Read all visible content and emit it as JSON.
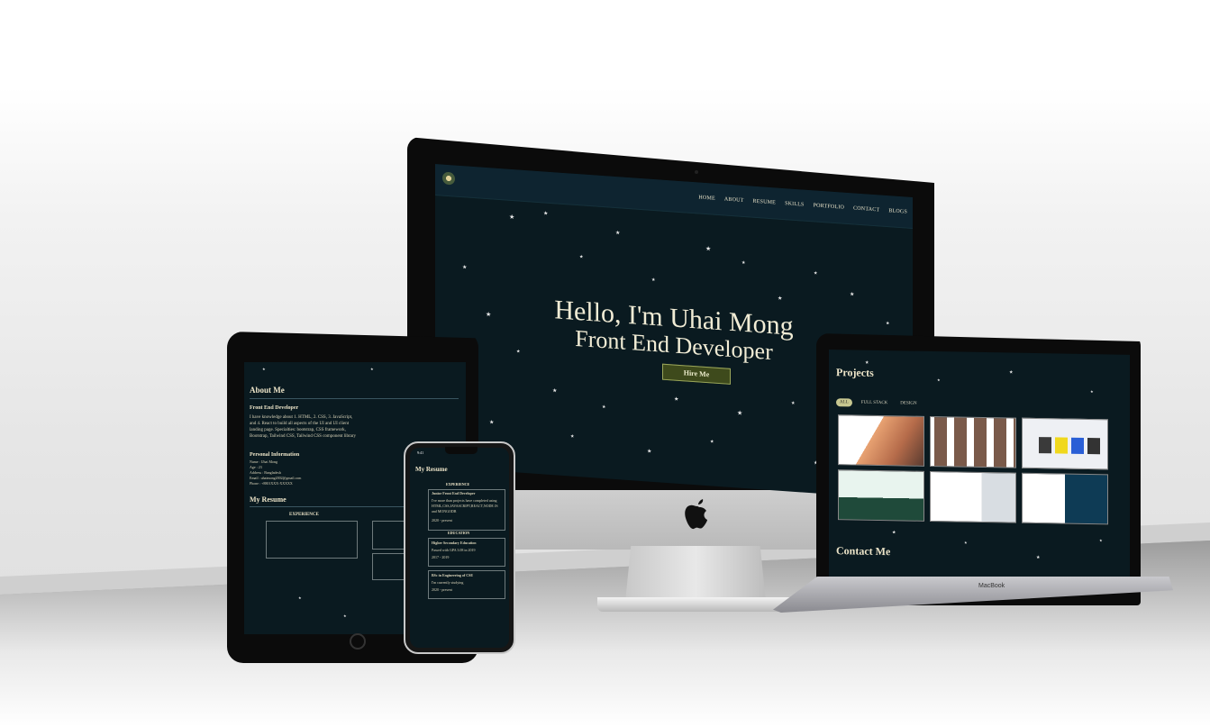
{
  "imac": {
    "nav": [
      "HOME",
      "ABOUT",
      "RESUME",
      "SKILLS",
      "PORTFOLIO",
      "CONTACT",
      "BLOGS"
    ],
    "hero_line1": "Hello, I'm Uhai Mong",
    "hero_line2": "Front End Developer",
    "cta": "Hire Me"
  },
  "macbook": {
    "section_title": "Projects",
    "filters": [
      "ALL",
      "FULL STACK",
      "DESIGN"
    ],
    "contact_title": "Contact Me",
    "brand": "MacBook"
  },
  "ipad": {
    "about_title": "About Me",
    "role": "Front End Developer",
    "about_text": "I have knowledge about 1. HTML, 2. CSS, 3. JavaScript, and 4. React to build all aspects of the UI and UI client landing page. Specialties: bootstrap, CSS framework, Bootstrap, Tailwind CSS, Tailwind CSS component library to build seamless UI containers clear.",
    "personal_title": "Personal Information",
    "personal": [
      "Name : Uhai Mong",
      "Age : 23",
      "Address : Bangladesh",
      "Email : uhaimong2002@gmail.com",
      "Phone : +8801XXX-XXXXX"
    ],
    "resume_title": "My Resume",
    "experience_label": "EXPERIENCE"
  },
  "iphone": {
    "time": "9:41",
    "resume_title": "My Resume",
    "experience_label": "EXPERIENCE",
    "education_label": "EDUCATION",
    "exp_item": "Junior Front End Developer",
    "exp_text": "I've more than projects have completed using HTML,CSS,JAVASCRIPT,REACT,NODE JS and MONGODB",
    "exp_date": "2020 - present",
    "edu_item": "Higher Secondary Education",
    "edu_text": "Passed with GPA 3.08 in 2019",
    "edu_date": "2017 - 2019",
    "edu_item2": "BSc in Engineering of CSE",
    "edu_text2": "I'm currently studying",
    "edu_date2": "2020 - present"
  },
  "colors": {
    "screen_bg": "#0a1a20",
    "accent_text": "#f1ecd5",
    "button_bg": "#3e4a1c",
    "filter_active": "#c7c790"
  }
}
